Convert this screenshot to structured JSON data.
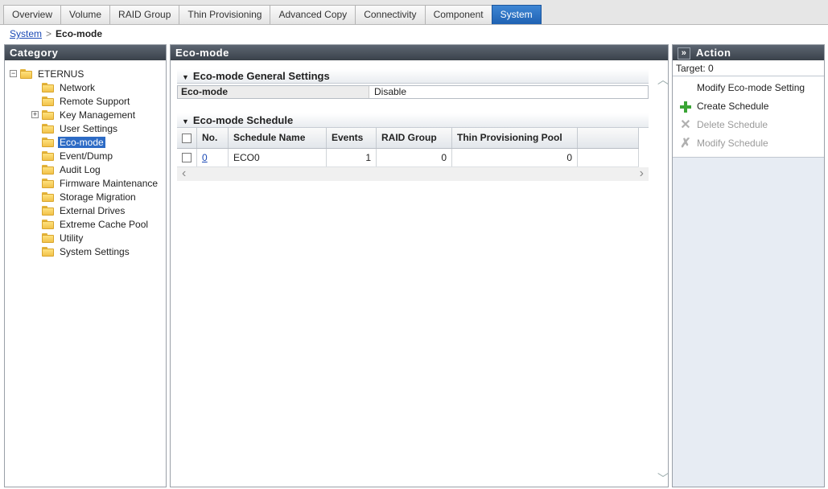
{
  "tabs": [
    {
      "label": "Overview"
    },
    {
      "label": "Volume"
    },
    {
      "label": "RAID Group"
    },
    {
      "label": "Thin Provisioning"
    },
    {
      "label": "Advanced Copy"
    },
    {
      "label": "Connectivity"
    },
    {
      "label": "Component"
    },
    {
      "label": "System",
      "active": true
    }
  ],
  "breadcrumb": {
    "parent": "System",
    "separator": ">",
    "current": "Eco-mode"
  },
  "category": {
    "title": "Category",
    "tree": {
      "root": "ETERNUS",
      "items": [
        {
          "label": "Network"
        },
        {
          "label": "Remote Support"
        },
        {
          "label": "Key Management",
          "expandable": true
        },
        {
          "label": "User Settings"
        },
        {
          "label": "Eco-mode",
          "selected": true
        },
        {
          "label": "Event/Dump"
        },
        {
          "label": "Audit Log"
        },
        {
          "label": "Firmware Maintenance"
        },
        {
          "label": "Storage Migration"
        },
        {
          "label": "External Drives"
        },
        {
          "label": "Extreme Cache Pool"
        },
        {
          "label": "Utility"
        },
        {
          "label": "System Settings"
        }
      ]
    }
  },
  "main": {
    "title": "Eco-mode",
    "general": {
      "title": "Eco-mode General Settings",
      "key": "Eco-mode",
      "value": "Disable"
    },
    "schedule": {
      "title": "Eco-mode Schedule",
      "columns": [
        "No.",
        "Schedule Name",
        "Events",
        "RAID Group",
        "Thin Provisioning Pool"
      ],
      "rows": [
        {
          "no": "0",
          "name": "ECO0",
          "events": "1",
          "raid_group": "0",
          "tpp": "0"
        }
      ]
    }
  },
  "action": {
    "title": "Action",
    "collapse_glyph": "»",
    "target": "Target: 0",
    "items": [
      {
        "label": "Modify Eco-mode Setting",
        "icon": "none",
        "enabled": true
      },
      {
        "label": "Create Schedule",
        "icon": "plus-icon",
        "enabled": true
      },
      {
        "label": "Delete Schedule",
        "icon": "delete-icon",
        "enabled": false
      },
      {
        "label": "Modify Schedule",
        "icon": "modify-icon",
        "enabled": false
      }
    ]
  },
  "colors": {
    "active_tab": "#1f62b3",
    "panel_header": "#3a414a",
    "selected_tree_item": "#2d6bc5",
    "link": "#1a49b5",
    "create_icon": "#3aa535"
  }
}
